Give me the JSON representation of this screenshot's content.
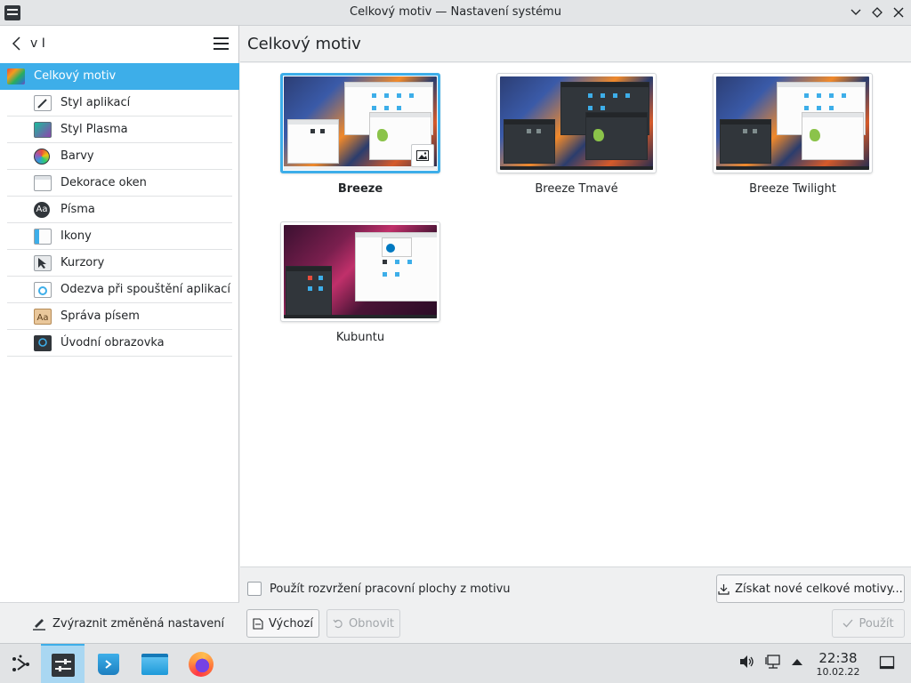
{
  "window": {
    "title": "Celkový motiv — Nastavení systému"
  },
  "sidebar": {
    "search_text": "v I",
    "items": [
      {
        "label": "Celkový motiv",
        "icon": "global-theme-icon",
        "active": true
      },
      {
        "label": "Styl aplikací",
        "icon": "application-style-icon"
      },
      {
        "label": "Styl Plasma",
        "icon": "plasma-style-icon"
      },
      {
        "label": "Barvy",
        "icon": "colors-icon"
      },
      {
        "label": "Dekorace oken",
        "icon": "window-decoration-icon"
      },
      {
        "label": "Písma",
        "icon": "fonts-icon",
        "glyph": "Aa"
      },
      {
        "label": "Ikony",
        "icon": "icons-icon"
      },
      {
        "label": "Kurzory",
        "icon": "cursors-icon"
      },
      {
        "label": "Odezva při spouštění aplikací",
        "icon": "launch-feedback-icon"
      },
      {
        "label": "Správa písem",
        "icon": "font-management-icon",
        "glyph": "Aa"
      },
      {
        "label": "Úvodní obrazovka",
        "icon": "splash-screen-icon"
      }
    ],
    "footer_label": "Zvýraznit změněná nastavení"
  },
  "main": {
    "title": "Celkový motiv",
    "themes": [
      {
        "name": "Breeze",
        "selected": true,
        "variant": "light"
      },
      {
        "name": "Breeze Tmavé",
        "selected": false,
        "variant": "dark"
      },
      {
        "name": "Breeze Twilight",
        "selected": false,
        "variant": "twilight"
      },
      {
        "name": "Kubuntu",
        "selected": false,
        "variant": "kubuntu"
      }
    ],
    "checkbox_label": "Použít rozvržení pracovní plochy z motivu",
    "get_new_label": "Získat nové celkové motivy...",
    "defaults_label": "Výchozí",
    "reset_label": "Obnovit",
    "apply_label": "Použít"
  },
  "taskbar": {
    "time": "22:38",
    "date": "10.02.22"
  },
  "colors": {
    "accent": "#3daee9",
    "window_bg": "#eff0f1",
    "view_bg": "#ffffff",
    "text": "#232629"
  }
}
